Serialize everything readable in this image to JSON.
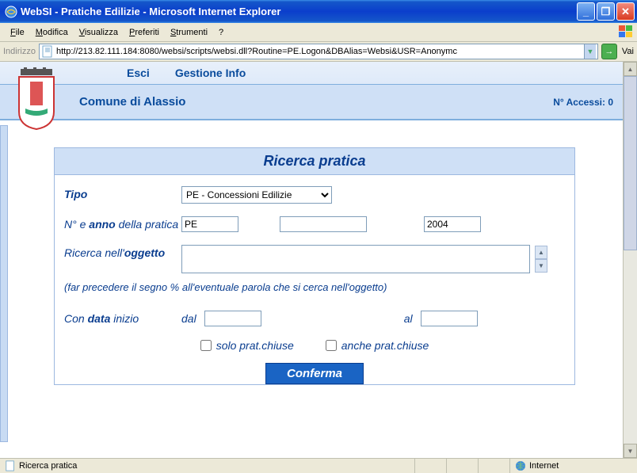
{
  "window": {
    "title": "WebSI - Pratiche Edilizie - Microsoft Internet Explorer"
  },
  "menu": {
    "file": "File",
    "modifica": "Modifica",
    "visualizza": "Visualizza",
    "preferiti": "Preferiti",
    "strumenti": "Strumenti",
    "help": "?"
  },
  "addressbar": {
    "label": "Indirizzo",
    "url": "http://213.82.111.184:8080/websi/scripts/websi.dll?Routine=PE.Logon&DBAlias=Websi&USR=Anonymc",
    "go": "Vai"
  },
  "topnav": {
    "esci": "Esci",
    "gestione": "Gestione Info"
  },
  "header": {
    "org": "Comune di Alassio",
    "accessi": "N° Accessi: 0"
  },
  "form": {
    "title": "Ricerca pratica",
    "tipo_label": "Tipo",
    "tipo_value": "PE - Concessioni Edilizie",
    "num_label_pre": "N° e ",
    "num_label_bold": "anno",
    "num_label_post": " della pratica",
    "num_prefix": "PE",
    "num_value": "",
    "num_year": "2004",
    "ogg_label_pre": "Ricerca nell'",
    "ogg_label_bold": "oggetto",
    "ogg_value": "",
    "hint": "(far precedere il segno % all'eventuale parola che si cerca nell'oggetto)",
    "data_label_pre": "Con ",
    "data_label_bold": "data",
    "data_label_post": " inizio",
    "dal": "dal",
    "al": "al",
    "data_from": "",
    "data_to": "",
    "chk_solo": "solo prat.chiuse",
    "chk_anche": "anche prat.chiuse",
    "confirm": "Conferma"
  },
  "status": {
    "left": "Ricerca pratica",
    "zone": "Internet"
  }
}
